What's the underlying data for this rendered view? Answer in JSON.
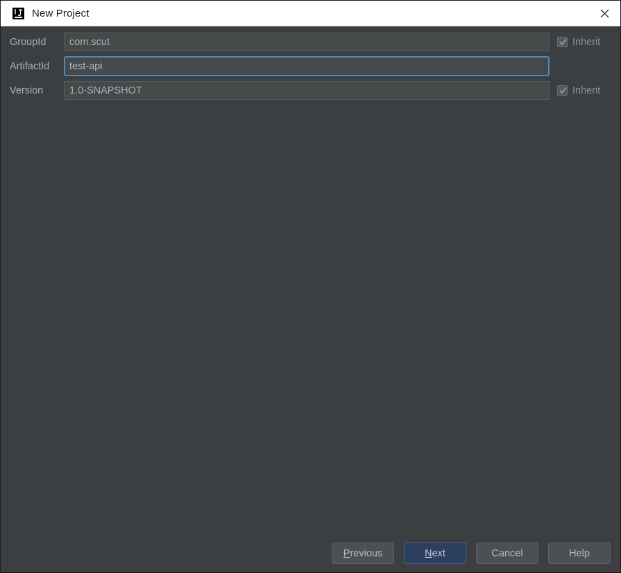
{
  "window": {
    "title": "New Project",
    "app_icon": "intellij-idea-icon",
    "close_icon": "close-icon",
    "background_color": "#3c3f41",
    "titlebar_background_color": "#ffffff"
  },
  "form": {
    "rows": [
      {
        "label": "GroupId",
        "value": "com.scut",
        "placeholder": "",
        "focused": false,
        "field_name": "groupid",
        "inherit": {
          "present": true,
          "label": "Inherit",
          "checked": true,
          "disabled": true
        }
      },
      {
        "label": "ArtifactId",
        "value": "test-api",
        "placeholder": "",
        "focused": true,
        "field_name": "artifactid",
        "inherit": {
          "present": false,
          "label": "",
          "checked": false,
          "disabled": false
        }
      },
      {
        "label": "Version",
        "value": "1.0-SNAPSHOT",
        "placeholder": "",
        "focused": false,
        "field_name": "version",
        "inherit": {
          "present": true,
          "label": "Inherit",
          "checked": true,
          "disabled": true
        }
      }
    ]
  },
  "buttons": {
    "previous": {
      "label": "Previous",
      "mnemonic": "P",
      "default": false
    },
    "next": {
      "label": "Next",
      "mnemonic": "N",
      "default": true
    },
    "cancel": {
      "label": "Cancel",
      "mnemonic": "",
      "default": false
    },
    "help": {
      "label": "Help",
      "mnemonic": "",
      "default": false
    }
  },
  "colors": {
    "dialog_background": "#3c3f41",
    "field_background": "#45494a",
    "focus_border": "#4a88c7",
    "default_button_background": "#2d3f5f",
    "button_background": "#4c5052",
    "label_text": "#a9b0b4"
  }
}
